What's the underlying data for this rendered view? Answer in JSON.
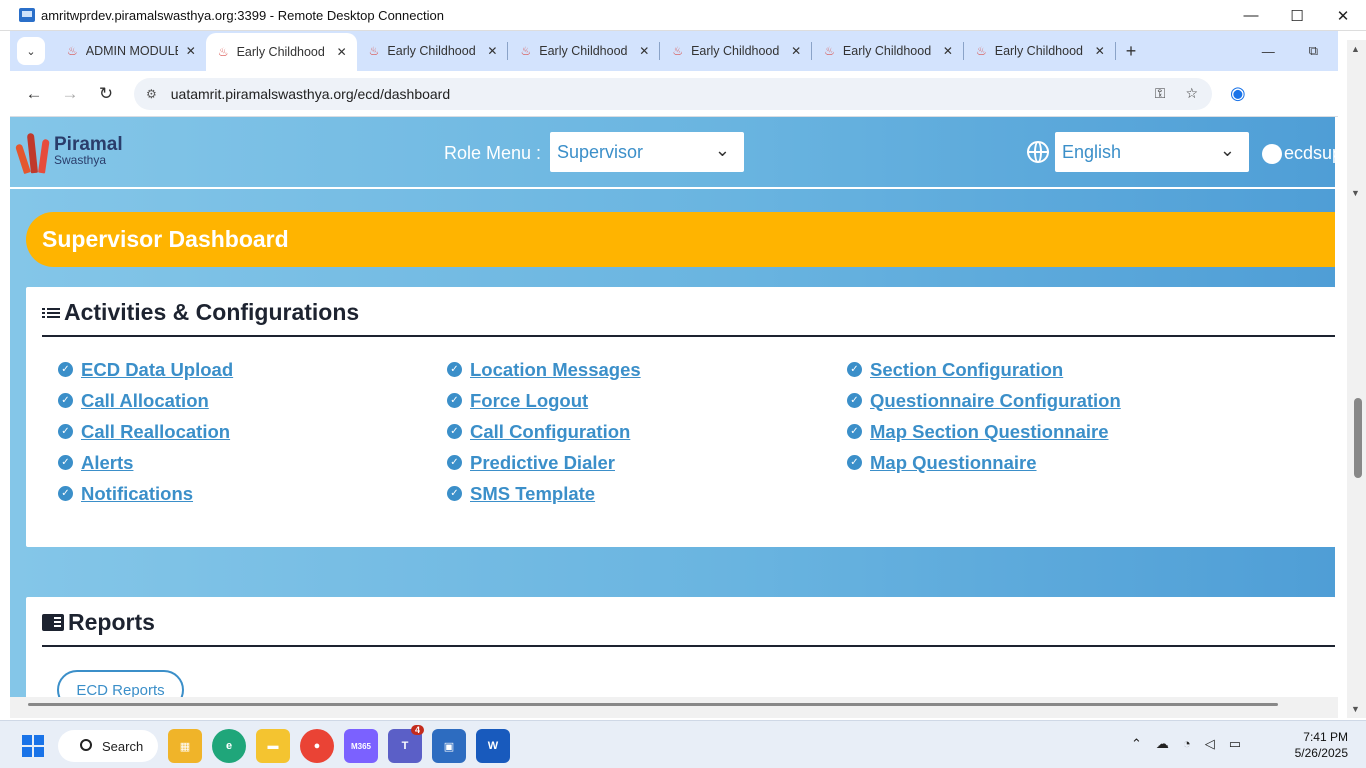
{
  "rdp": {
    "title": "amritwprdev.piramalswasthya.org:3399 - Remote Desktop Connection",
    "minimize": "—",
    "maximize": "☐",
    "close": "✕"
  },
  "browser": {
    "tabs": [
      {
        "label": "ADMIN MODULE"
      },
      {
        "label": "Early Childhood"
      },
      {
        "label": "Early Childhood"
      },
      {
        "label": "Early Childhood"
      },
      {
        "label": "Early Childhood"
      },
      {
        "label": "Early Childhood"
      },
      {
        "label": "Early Childhood"
      }
    ],
    "tab_search": "⌄",
    "new_tab": "+",
    "tab_close": "✕",
    "url": "uatamrit.piramalswasthya.org/ecd/dashboard",
    "back": "←",
    "forward": "→",
    "reload": "↻",
    "tab_minimize": "—",
    "tab_restore": "⧉",
    "key_icon": "⚿",
    "star_icon": "☆",
    "profile_icon": "◉"
  },
  "header": {
    "logo_name": "Piramal",
    "logo_sub": "Swasthya",
    "role_label": "Role Menu :",
    "role_value": "Supervisor",
    "language_value": "English",
    "user": "ecdsup",
    "chevron": "⌄"
  },
  "dashboard": {
    "title": "Supervisor Dashboard"
  },
  "activities": {
    "title": "Activities & Configurations",
    "col1": [
      "ECD Data Upload",
      "Call Allocation",
      "Call Reallocation",
      "Alerts",
      "Notifications"
    ],
    "col2": [
      "Location Messages",
      "Force Logout",
      "Call Configuration",
      "Predictive Dialer",
      "SMS Template"
    ],
    "col3": [
      "Section Configuration",
      "Questionnaire Configuration",
      "Map Section Questionnaire",
      "Map Questionnaire"
    ]
  },
  "reports": {
    "title": "Reports",
    "button": "ECD Reports"
  },
  "taskbar": {
    "search": "Search",
    "m365": "M365",
    "teams_badge": "4",
    "time": "7:41 PM",
    "date": "5/26/2025"
  },
  "colors": {
    "accent": "#3b8fc9",
    "banner": "#ffb400",
    "header_gradient_start": "#84c6e8",
    "header_gradient_end": "#4f9ed6"
  }
}
